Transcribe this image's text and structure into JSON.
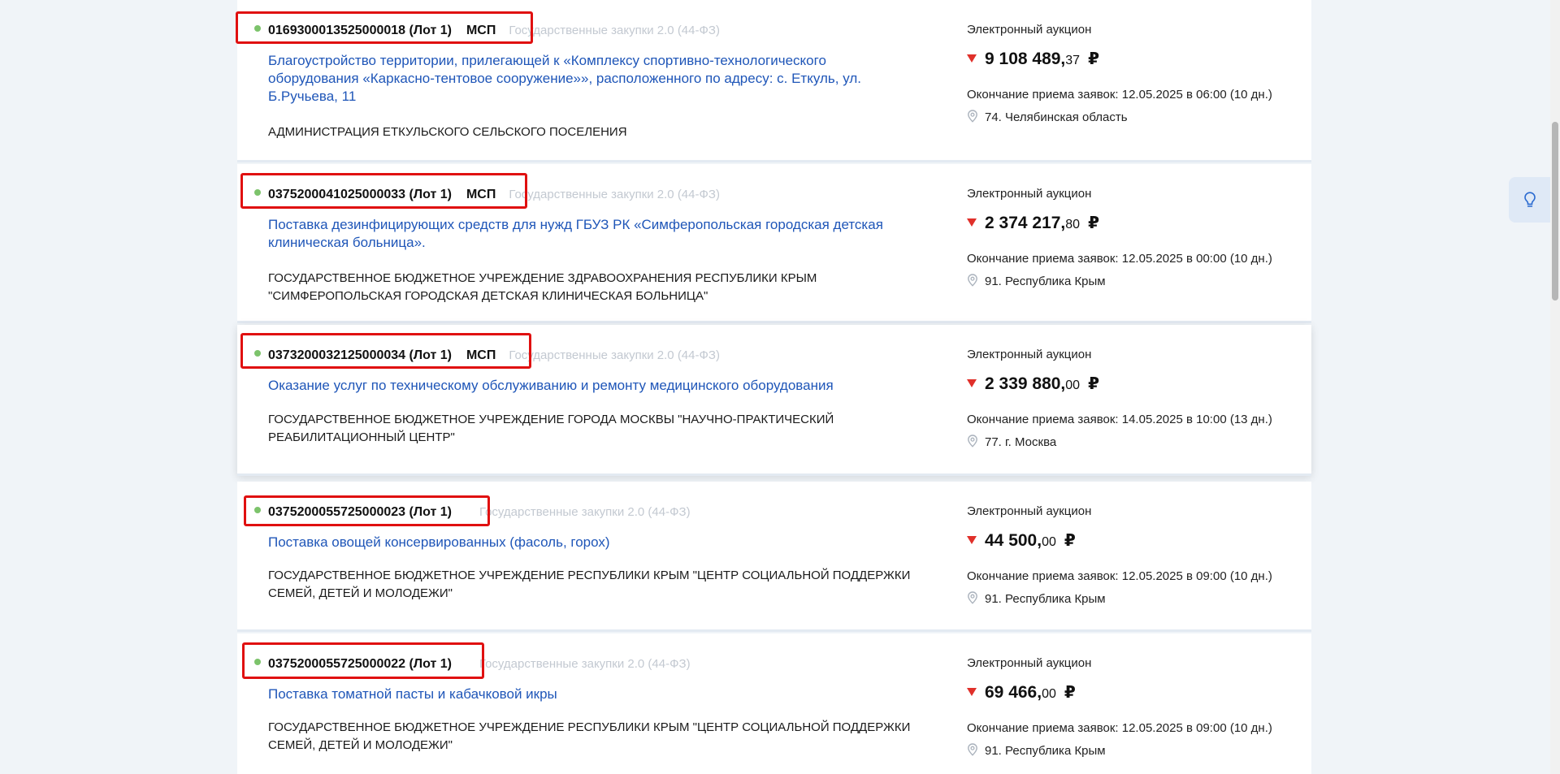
{
  "tenders": [
    {
      "number": "0169300013525000018 (Лот 1)",
      "msp": "МСП",
      "platform": "Государственные закупки 2.0 (44-ФЗ)",
      "title": "Благоустройство территории, прилегающей к «Комплексу спортивно-технологического оборудования «Каркасно-тентовое сооружение»», расположенного по адресу: с. Еткуль, ул. Б.Ручьева, 11",
      "customer": "АДМИНИСТРАЦИЯ ЕТКУЛЬСКОГО СЕЛЬСКОГО ПОСЕЛЕНИЯ",
      "type": "Электронный аукцион",
      "price_int": "9 108 489,",
      "price_dec": "37",
      "currency": "₽",
      "deadline": "Окончание приема заявок: 12.05.2025 в 06:00 (10 дн.)",
      "region": "74. Челябинская область"
    },
    {
      "number": "0375200041025000033 (Лот 1)",
      "msp": "МСП",
      "platform": "Государственные закупки 2.0 (44-ФЗ)",
      "title": "Поставка дезинфицирующих средств для нужд ГБУЗ РК «Симферопольская городская детская клиническая больница».",
      "customer": "ГОСУДАРСТВЕННОЕ БЮДЖЕТНОЕ УЧРЕЖДЕНИЕ ЗДРАВООХРАНЕНИЯ РЕСПУБЛИКИ КРЫМ \"СИМФЕРОПОЛЬСКАЯ ГОРОДСКАЯ ДЕТСКАЯ КЛИНИЧЕСКАЯ БОЛЬНИЦА\"",
      "type": "Электронный аукцион",
      "price_int": "2 374 217,",
      "price_dec": "80",
      "currency": "₽",
      "deadline": "Окончание приема заявок: 12.05.2025 в 00:00 (10 дн.)",
      "region": "91. Республика Крым"
    },
    {
      "number": "0373200032125000034 (Лот 1)",
      "msp": "МСП",
      "platform": "Государственные закупки 2.0 (44-ФЗ)",
      "title": "Оказание услуг по техническому обслуживанию и ремонту медицинского оборудования",
      "customer": "ГОСУДАРСТВЕННОЕ БЮДЖЕТНОЕ УЧРЕЖДЕНИЕ ГОРОДА МОСКВЫ \"НАУЧНО-ПРАКТИЧЕСКИЙ РЕАБИЛИТАЦИОННЫЙ ЦЕНТР\"",
      "type": "Электронный аукцион",
      "price_int": "2 339 880,",
      "price_dec": "00",
      "currency": "₽",
      "deadline": "Окончание приема заявок: 14.05.2025 в 10:00 (13 дн.)",
      "region": "77. г. Москва"
    },
    {
      "number": "0375200055725000023 (Лот 1)",
      "msp": "",
      "platform": "Государственные закупки 2.0 (44-ФЗ)",
      "title": "Поставка овощей консервированных (фасоль, горох)",
      "customer": "ГОСУДАРСТВЕННОЕ БЮДЖЕТНОЕ УЧРЕЖДЕНИЕ РЕСПУБЛИКИ КРЫМ \"ЦЕНТР СОЦИАЛЬНОЙ ПОДДЕРЖКИ СЕМЕЙ, ДЕТЕЙ И МОЛОДЕЖИ\"",
      "type": "Электронный аукцион",
      "price_int": "44 500,",
      "price_dec": "00",
      "currency": "₽",
      "deadline": "Окончание приема заявок: 12.05.2025 в 09:00 (10 дн.)",
      "region": "91. Республика Крым"
    },
    {
      "number": "0375200055725000022 (Лот 1)",
      "msp": "",
      "platform": "Государственные закупки 2.0 (44-ФЗ)",
      "title": "Поставка томатной пасты и кабачковой икры",
      "customer": "ГОСУДАРСТВЕННОЕ БЮДЖЕТНОЕ УЧРЕЖДЕНИЕ РЕСПУБЛИКИ КРЫМ \"ЦЕНТР СОЦИАЛЬНОЙ ПОДДЕРЖКИ СЕМЕЙ, ДЕТЕЙ И МОЛОДЕЖИ\"",
      "type": "Электронный аукцион",
      "price_int": "69 466,",
      "price_dec": "00",
      "currency": "₽",
      "deadline": "Окончание приема заявок: 12.05.2025 в 09:00 (10 дн.)",
      "region": "91. Республика Крым"
    }
  ],
  "colors": {
    "link": "#1f56b8",
    "highlight": "#e01010",
    "status_dot": "#7cc36b",
    "price_down": "#e0302a"
  },
  "icons": {
    "hint": "lightbulb-icon",
    "region": "map-pin-icon",
    "price_trend": "triangle-down-icon"
  }
}
